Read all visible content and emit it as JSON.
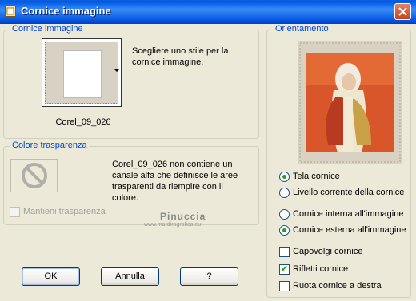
{
  "window": {
    "title": "Cornice immagine"
  },
  "frame_group": {
    "legend": "Cornice immagine",
    "description": "Scegliere uno stile per la cornice immagine.",
    "selected_frame": "Corel_09_026"
  },
  "transparency_group": {
    "legend": "Colore trasparenza",
    "message": "Corel_09_026 non contiene un canale alfa che definisce le aree trasparenti da riempire con il colore.",
    "keep_label": "Mantieni trasparenza",
    "keep_checked": false
  },
  "orientation_group": {
    "legend": "Orientamento",
    "options": [
      {
        "label": "Tela cornice",
        "selected": true
      },
      {
        "label": "Livello corrente della cornice",
        "selected": false
      },
      {
        "label": "Cornice interna all'immagine",
        "selected": false
      },
      {
        "label": "Cornice esterna all'immagine",
        "selected": true
      }
    ],
    "checkboxes": [
      {
        "label": "Capovolgi cornice",
        "checked": false
      },
      {
        "label": "Rifletti cornice",
        "checked": true
      },
      {
        "label": "Ruota cornice a destra",
        "checked": false
      }
    ]
  },
  "watermark": {
    "name": "Pinuccia",
    "url": "www.mardiragrafica.eu"
  },
  "buttons": {
    "ok": "OK",
    "cancel": "Annulla",
    "help": "?"
  }
}
